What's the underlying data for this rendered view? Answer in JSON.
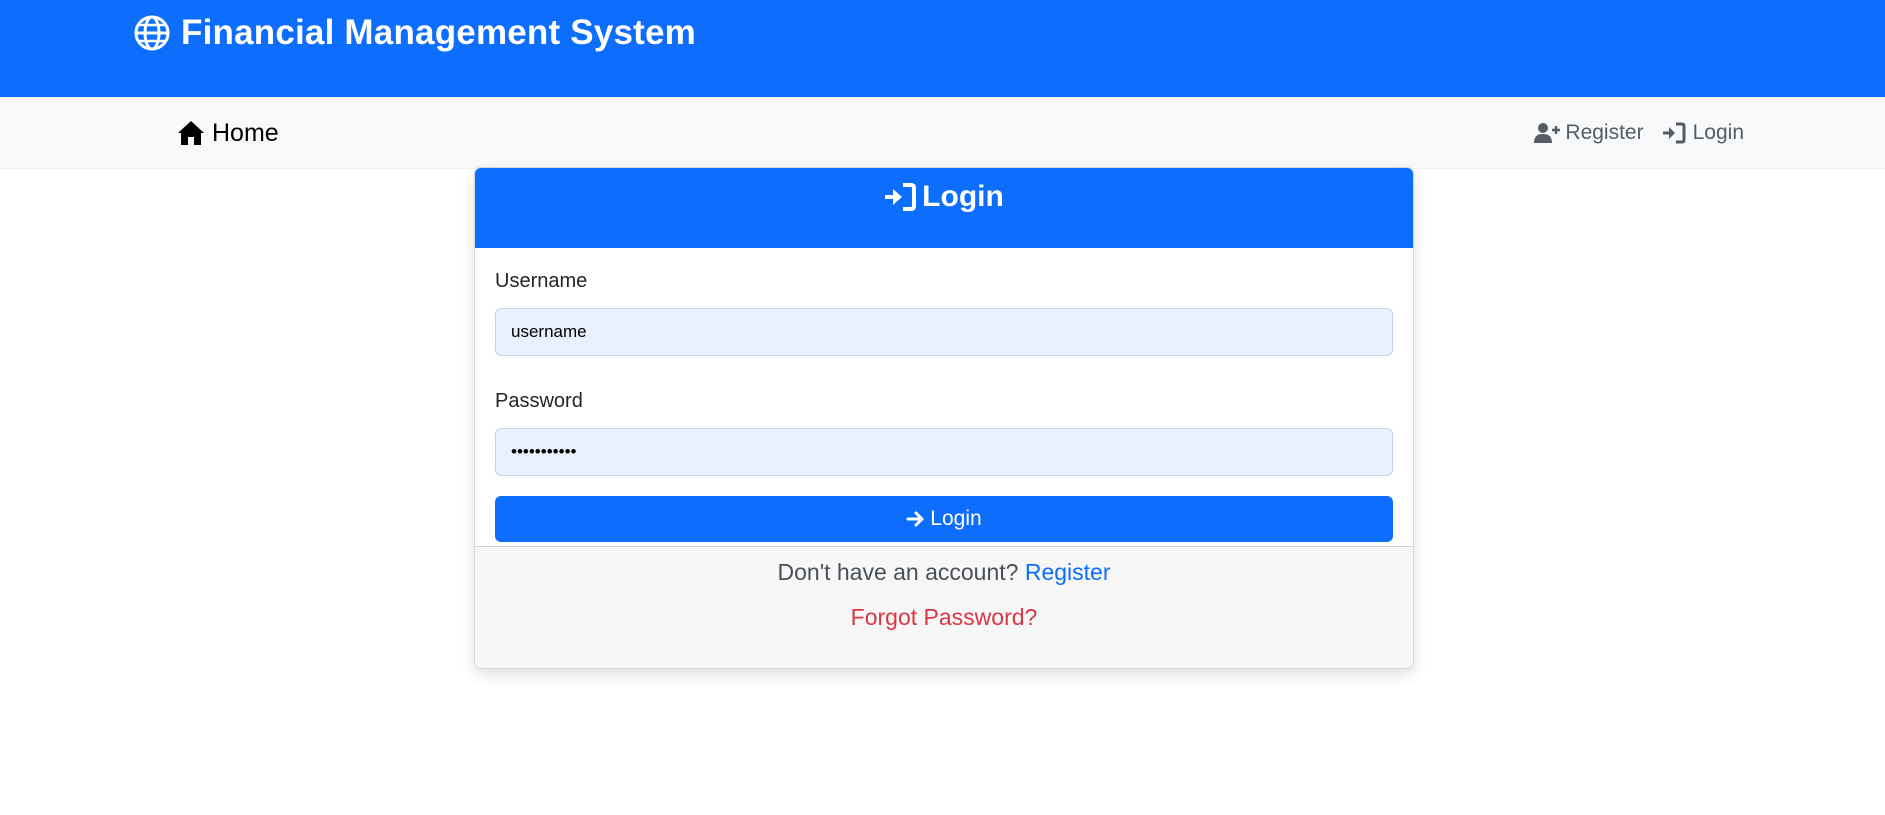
{
  "header": {
    "title": "Financial Management System",
    "icon": "globe-icon",
    "color": "#0d6efd"
  },
  "navbar": {
    "home_label": "Home",
    "home_icon": "house-icon",
    "register_label": "Register",
    "register_icon": "user-plus-icon",
    "login_label": "Login",
    "login_icon": "sign-in-icon"
  },
  "login_card": {
    "title": "Login",
    "title_icon": "sign-in-icon",
    "username_label": "Username",
    "username_value": "username",
    "password_label": "Password",
    "password_value": "•••••••••••",
    "submit_label": "Login",
    "submit_icon": "arrow-right-icon",
    "footer_prompt": "Don't have an account?",
    "footer_register_link": "Register",
    "forgot_password_link": "Forgot Password?"
  },
  "colors": {
    "primary": "#0d6efd",
    "danger": "#dc3545",
    "navbar_bg": "#f8f9fa"
  }
}
